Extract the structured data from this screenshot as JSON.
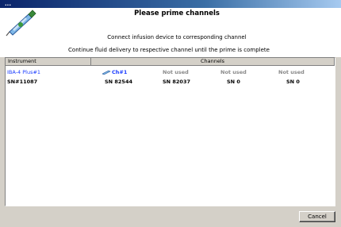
{
  "window": {
    "title": "..."
  },
  "header": {
    "title": "Please prime channels",
    "line1": "Connect infusion device to corresponding channel",
    "line2": "Continue fluid delivery to respective channel until the prime is complete"
  },
  "table": {
    "columns": {
      "instrument": "Instrument",
      "channels": "Channels"
    },
    "rows": [
      {
        "instrument": "IBA-4 Plus#1",
        "ch1": "Ch#1",
        "ch2": "Not used",
        "ch3": "Not used",
        "ch4": "Not used"
      },
      {
        "instrument": "SN#11087",
        "ch1": "SN 82544",
        "ch2": "SN 82037",
        "ch3": "SN 0",
        "ch4": "SN 0"
      }
    ]
  },
  "buttons": {
    "cancel": "Cancel"
  },
  "colors": {
    "link_blue": "#1a3cff",
    "disabled_gray": "#8a8a8a",
    "dialog_bg": "#d4d0c8"
  },
  "icons": {
    "header_logo": "syringe-icon",
    "channel_icon": "pump-icon"
  }
}
